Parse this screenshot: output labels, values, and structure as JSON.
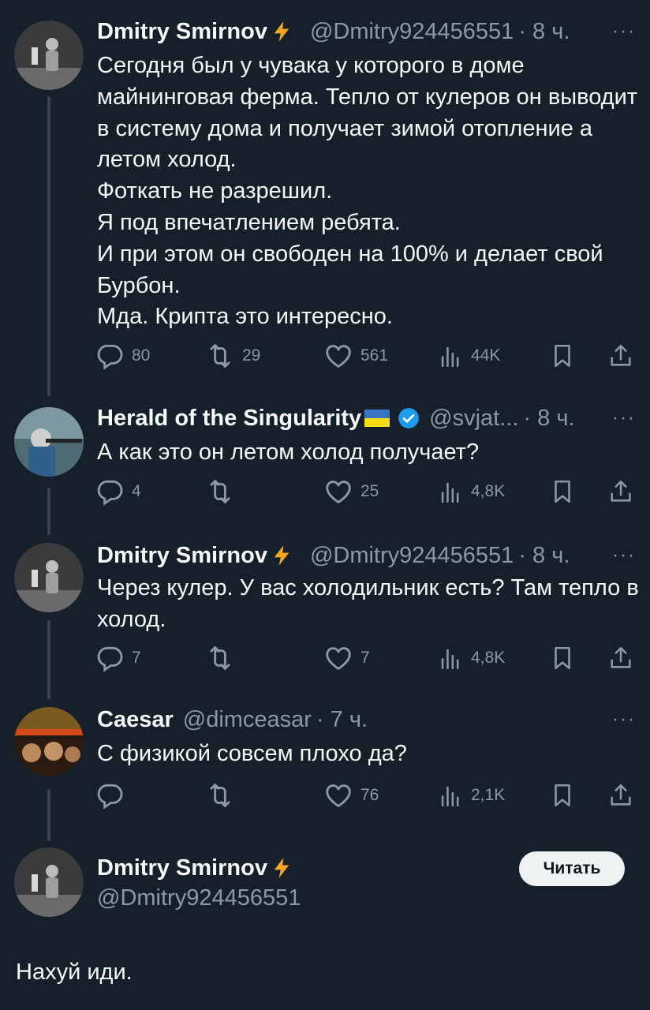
{
  "tweets": [
    {
      "name": "Dmitry Smirnov",
      "handle": "@Dmitry924456551",
      "time": "· 8 ч.",
      "more": "···",
      "text": "Сегодня был у чувака у которого в доме майнинговая ферма. Тепло от кулеров он выводит в систему дома и получает зимой отопление а летом холод.\nФоткать не разрешил.\nЯ под впечатлением ребята.\nИ при этом он свободен на 100% и делает свой Бурбон.\nМда. Крипта это интересно.",
      "stats": {
        "replies": "80",
        "reposts": "29",
        "likes": "561",
        "views": "44K"
      }
    },
    {
      "name": "Herald of the Singularity",
      "handle": "@svjat...",
      "time": "· 8 ч.",
      "more": "···",
      "text": "А как это он летом холод получает?",
      "stats": {
        "replies": "4",
        "reposts": "",
        "likes": "25",
        "views": "4,8K"
      }
    },
    {
      "name": "Dmitry Smirnov",
      "handle": "@Dmitry924456551",
      "time": "· 8 ч.",
      "more": "···",
      "text": "Через кулер. У вас холодильник есть? Там тепло в холод.",
      "stats": {
        "replies": "7",
        "reposts": "",
        "likes": "7",
        "views": "4,8K"
      }
    },
    {
      "name": "Caesar",
      "handle": "@dimceasar",
      "time": "· 7 ч.",
      "more": "···",
      "text": "С физикой совсем плохо да?",
      "stats": {
        "replies": "",
        "reposts": "",
        "likes": "76",
        "views": "2,1K"
      }
    }
  ],
  "main_tweet": {
    "name": "Dmitry Smirnov",
    "handle": "@Dmitry924456551",
    "follow_label": "Читать",
    "text": "Нахуй иди."
  },
  "colors": {
    "background": "#15202b",
    "text": "#f7f9f9",
    "muted": "#8b98a5",
    "verified": "#1d9bf0",
    "lightning": "#f5a623"
  }
}
